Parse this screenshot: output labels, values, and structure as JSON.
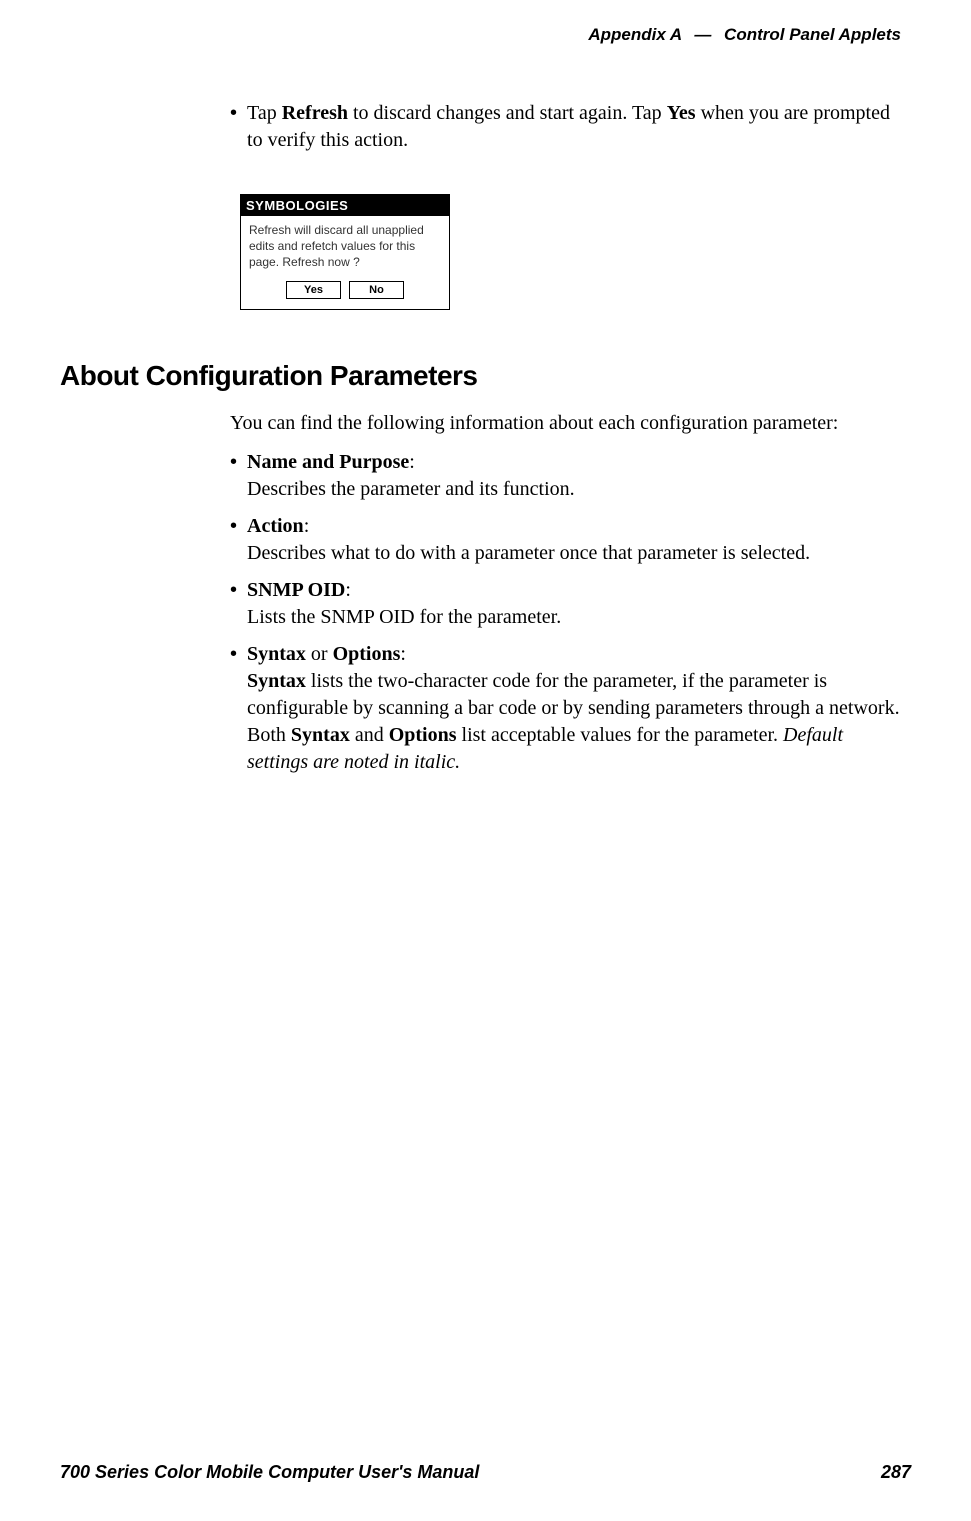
{
  "header": {
    "appendix": "Appendix A",
    "dash": "—",
    "title": "Control Panel Applets"
  },
  "intro_bullet": {
    "pre": "Tap ",
    "bold1": "Refresh",
    "mid1": " to discard changes and start again. Tap ",
    "bold2": "Yes",
    "post": " when you are prompted to verify this action."
  },
  "dialog": {
    "title": "SYMBOLOGIES",
    "body": "Refresh will discard all unapplied edits and refetch values for this page. Refresh now ?",
    "yes": "Yes",
    "no": "No"
  },
  "section_heading": "About Configuration Parameters",
  "section_para": "You can find the following information about each configuration parameter:",
  "params": {
    "name_purpose": {
      "label": "Name and Purpose",
      "colon": ":",
      "desc": "Describes the parameter and its function."
    },
    "action": {
      "label": "Action",
      "colon": ":",
      "desc": "Describes what to do with a parameter once that parameter is selected."
    },
    "snmp": {
      "label": "SNMP OID",
      "colon": ":",
      "desc": "Lists the SNMP OID for the parameter."
    },
    "syntax": {
      "label1": "Syntax",
      "or": " or ",
      "label2": "Options",
      "colon": ":",
      "desc_bold1": "Syntax",
      "desc_part1": " lists the two-character code for the parameter, if the parameter is configurable by scanning a bar code or by sending parameters through a network. Both ",
      "desc_bold2": "Syntax",
      "desc_part2": " and ",
      "desc_bold3": "Options",
      "desc_part3": " list acceptable values for the parameter. ",
      "desc_italic": "Default settings are noted in italic."
    }
  },
  "footer": {
    "left": "700 Series Color Mobile Computer User's Manual",
    "right": "287"
  }
}
